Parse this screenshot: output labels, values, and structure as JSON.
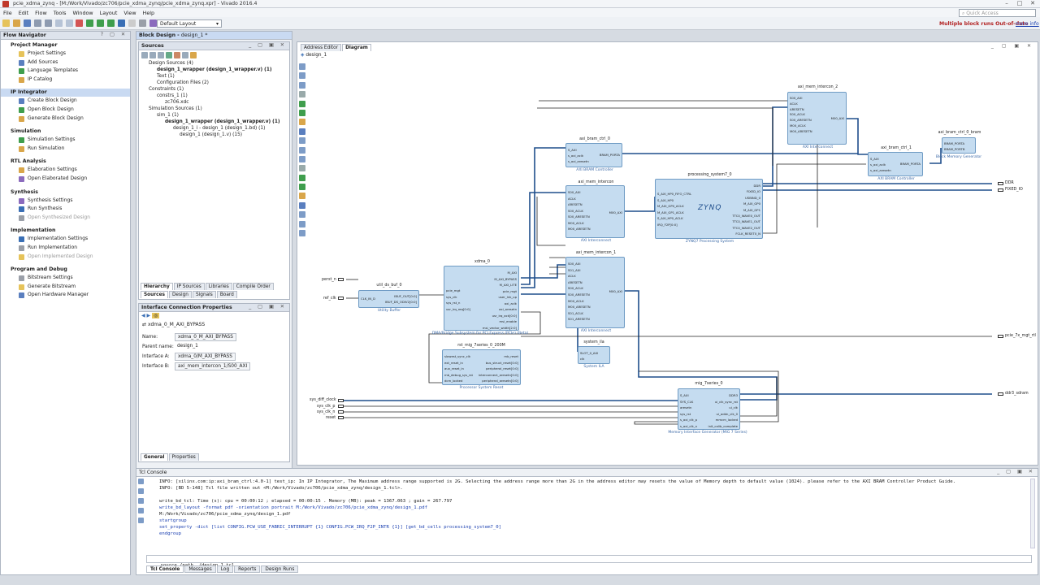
{
  "window": {
    "title": "pcie_xdma_zynq - [M:/Work/Vivado/zc706/pcie_xdma_zynq/pcie_xdma_zynq.xpr] - Vivado 2016.4"
  },
  "menu": [
    "File",
    "Edit",
    "Flow",
    "Tools",
    "Window",
    "Layout",
    "View",
    "Help"
  ],
  "toolbar": {
    "layout_select": "Default Layout",
    "quick_access_placeholder": "Quick Access",
    "status": "Multiple block runs Out-of-date",
    "more_info": "more info"
  },
  "flow_nav": {
    "title": "Flow Navigator",
    "sections": [
      {
        "label": "Project Manager",
        "items": [
          {
            "label": "Project Settings"
          },
          {
            "label": "Add Sources"
          },
          {
            "label": "Language Templates"
          },
          {
            "label": "IP Catalog"
          }
        ]
      },
      {
        "label": "IP Integrator",
        "items": [
          {
            "label": "Create Block Design"
          },
          {
            "label": "Open Block Design"
          },
          {
            "label": "Generate Block Design"
          }
        ]
      },
      {
        "label": "Simulation",
        "items": [
          {
            "label": "Simulation Settings"
          },
          {
            "label": "Run Simulation"
          }
        ]
      },
      {
        "label": "RTL Analysis",
        "items": [
          {
            "label": "Elaboration Settings"
          },
          {
            "label": "Open Elaborated Design"
          }
        ]
      },
      {
        "label": "Synthesis",
        "items": [
          {
            "label": "Synthesis Settings"
          },
          {
            "label": "Run Synthesis"
          },
          {
            "label": "Open Synthesized Design"
          }
        ]
      },
      {
        "label": "Implementation",
        "items": [
          {
            "label": "Implementation Settings"
          },
          {
            "label": "Run Implementation"
          },
          {
            "label": "Open Implemented Design"
          }
        ]
      },
      {
        "label": "Program and Debug",
        "items": [
          {
            "label": "Bitstream Settings"
          },
          {
            "label": "Generate Bitstream"
          },
          {
            "label": "Open Hardware Manager"
          }
        ]
      }
    ]
  },
  "block_design": {
    "title": "Block Design",
    "name": "design_1 *"
  },
  "sources": {
    "title": "Sources",
    "tree": [
      "Design Sources (4)",
      "design_1_wrapper (design_1_wrapper.v) (1)",
      "Text (1)",
      "Configuration Files (2)",
      "Constraints (1)",
      "constrs_1 (1)",
      "zc706.xdc",
      "Simulation Sources (1)",
      "sim_1 (1)",
      "design_1_wrapper (design_1_wrapper.v) (1)",
      "design_1_i - design_1 (design_1.bd) (1)",
      "design_1 (design_1.v) (15)"
    ],
    "tabs": [
      "Hierarchy",
      "IP Sources",
      "Libraries",
      "Compile Order"
    ],
    "subtabs": [
      "Sources",
      "Design",
      "Signals",
      "Board"
    ]
  },
  "props": {
    "title": "Interface Connection Properties",
    "selected": "xdma_0_M_AXI_BYPASS",
    "fields": [
      {
        "label": "Name:",
        "value": "xdma_0_M_AXI_BYPASS"
      },
      {
        "label": "Parent name:",
        "value": "design_1"
      },
      {
        "label": "Interface A:",
        "value": "xdma_0/M_AXI_BYPASS"
      },
      {
        "label": "Interface B:",
        "value": "axi_mem_intercon_1/S00_AXI"
      }
    ],
    "tabs": [
      "General",
      "Properties"
    ]
  },
  "diagram": {
    "tabs": [
      "Address Editor",
      "Diagram"
    ],
    "breadcrumb": "design_1",
    "blocks": {
      "axi_mem_intercon_2": {
        "title": "axi_mem_intercon_2",
        "sub": "AXI Interconnect",
        "ports": [
          "S00_AXI",
          "ACLK",
          "ARESETN",
          "S00_ACLK",
          "S00_ARESETN",
          "M00_ACLK",
          "M00_ARESETN"
        ],
        "out": [
          "M00_AXI"
        ]
      },
      "axi_bram_ctrl_0": {
        "title": "axi_bram_ctrl_0",
        "sub": "AXI BRAM Controller",
        "ports": [
          "S_AXI",
          "s_axi_aclk",
          "s_axi_aresetn"
        ],
        "out": [
          "BRAM_PORTA"
        ]
      },
      "axi_bram_ctrl_1": {
        "title": "axi_bram_ctrl_1",
        "sub": "AXI BRAM Controller",
        "ports": [
          "S_AXI",
          "s_axi_aclk",
          "s_axi_aresetn"
        ],
        "out": [
          "BRAM_PORTA"
        ]
      },
      "bram": {
        "title": "axi_bram_ctrl_0_bram",
        "sub": "Block Memory Generator",
        "ports": [
          "BRAM_PORTA",
          "BRAM_PORTB"
        ]
      },
      "axi_mem_intercon": {
        "title": "axi_mem_intercon",
        "sub": "AXI Interconnect",
        "ports": [
          "S00_AXI",
          "ACLK",
          "ARESETN",
          "S00_ACLK",
          "S00_ARESETN",
          "M00_ACLK",
          "M00_ARESETN"
        ],
        "out": [
          "M00_AXI"
        ]
      },
      "ps7": {
        "title": "processing_system7_0",
        "sub": "ZYNQ7 Processing System",
        "logo": "ZYNQ",
        "ports": [
          "S_AXI_HP0_FIFO_CTRL",
          "S_AXI_HP0",
          "M_AXI_GP0_ACLK",
          "M_AXI_GP1_ACLK",
          "S_AXI_HP0_ACLK",
          "IRQ_F2P[0:0]"
        ],
        "out": [
          "DDR",
          "FIXED_IO",
          "USBIND_0",
          "M_AXI_GP0",
          "M_AXI_GP1",
          "TTC0_WAVE0_OUT",
          "TTC0_WAVE1_OUT",
          "TTC0_WAVE2_OUT",
          "FCLK_RESET0_N"
        ]
      },
      "util": {
        "title": "util_ds_buf_0",
        "sub": "Utility Buffer",
        "ports": [
          "CLK_IN_D"
        ],
        "out": [
          "IBUF_OUT[0:0]",
          "IBUF_DS_ODIV2[0:0]"
        ]
      },
      "xdma": {
        "title": "xdma_0",
        "sub": "DMA/Bridge Subsystem for PCI Express (PCIe) (Beta)",
        "ports": [
          "pcie_mgt",
          "sys_clk",
          "sys_rst_n",
          "usr_irq_req[0:0]"
        ],
        "out": [
          "M_AXI",
          "M_AXI_BYPASS",
          "M_AXI_LITE",
          "pcie_mgt",
          "user_lnk_up",
          "axi_aclk",
          "axi_aresetn",
          "usr_irq_ack[0:0]",
          "msi_enable",
          "msi_vector_width[2:0]"
        ]
      },
      "axi_mem_intercon_1": {
        "title": "axi_mem_intercon_1",
        "sub": "AXI Interconnect",
        "ports": [
          "S00_AXI",
          "S01_AXI",
          "ACLK",
          "ARESETN",
          "S00_ACLK",
          "S00_ARESETN",
          "M00_ACLK",
          "M00_ARESETN",
          "S01_ACLK",
          "S01_ARESETN"
        ],
        "out": [
          "M00_AXI"
        ]
      },
      "rst": {
        "title": "rst_mig_7series_0_200M",
        "sub": "Processor System Reset",
        "ports": [
          "slowest_sync_clk",
          "ext_reset_in",
          "aux_reset_in",
          "mb_debug_sys_rst",
          "dcm_locked"
        ],
        "out": [
          "mb_reset",
          "bus_struct_reset[0:0]",
          "peripheral_reset[0:0]",
          "interconnect_aresetn[0:0]",
          "peripheral_aresetn[0:0]"
        ]
      },
      "ila": {
        "title": "system_ila",
        "sub": "System ILA",
        "ports": [
          "SLOT_0_AXI",
          "clk"
        ]
      },
      "mig": {
        "title": "mig_7series_0",
        "sub": "Memory Interface Generator (MIG 7 Series)",
        "ports": [
          "S_AXI",
          "SYS_CLK",
          "aresetn",
          "sys_rst",
          "s_axi_clk_p",
          "s_axi_clk_n"
        ],
        "out": [
          "DDR3",
          "ui_clk_sync_rst",
          "ui_clk",
          "ui_addn_clk_0",
          "mmcm_locked",
          "init_calib_complete"
        ]
      }
    },
    "ext_ports": {
      "perst_n": "perst_n",
      "ref_clk": "ref_clk",
      "sys_diff_clock": "sys_diff_clock",
      "sys_clk_p": "sys_clk_p",
      "sys_clk_n": "sys_clk_n",
      "reset": "reset",
      "ddr": "DDR",
      "fixed_io": "FIXED_IO",
      "pcie_irq": "pcie_7x_mgt_rtl",
      "ddr3": "ddr3_sdram"
    }
  },
  "tcl": {
    "title": "Tcl Console",
    "lines": [
      {
        "t": "INFO: [xilinx.com:ip:axi_bram_ctrl:4.0-1] test_ip: In IP Integrator, The Maximum address range supported is 2G. Selecting the address range more than 2G in the address editor may resets the value of Memory depth to default value (1024). please refer to the AXI BRAM Controller Product Guide.",
        "c": "k"
      },
      {
        "t": "INFO: [BD 5-148] Tcl file written out <M:/Work/Vivado/zc706/pcie_xdma_zynq/design_1.tcl>.",
        "c": "k"
      },
      {
        "t": "",
        "c": "k"
      },
      {
        "t": "write_bd_tcl: Time (s): cpu = 00:00:12 ; elapsed = 00:00:15 . Memory (MB): peak = 1367.063 ; gain = 267.797",
        "c": "k"
      },
      {
        "t": "write_bd_layout -format pdf -orientation portrait M:/Work/Vivado/zc706/pcie_xdma_zynq/design_1.pdf",
        "c": "b"
      },
      {
        "t": "M:/Work/Vivado/zc706/pcie_xdma_zynq/design_1.pdf",
        "c": "k"
      },
      {
        "t": "startgroup",
        "c": "b"
      },
      {
        "t": "set_property -dict [list CONFIG.PCW_USE_FABRIC_INTERRUPT {1} CONFIG.PCW_IRQ_F2P_INTR {1}] [get_bd_cells processing_system7_0]",
        "c": "b"
      },
      {
        "t": "endgroup",
        "c": "b"
      }
    ],
    "input": "source /path../design_1.tcl",
    "tabs": [
      "Tcl Console",
      "Messages",
      "Log",
      "Reports",
      "Design Runs"
    ]
  }
}
